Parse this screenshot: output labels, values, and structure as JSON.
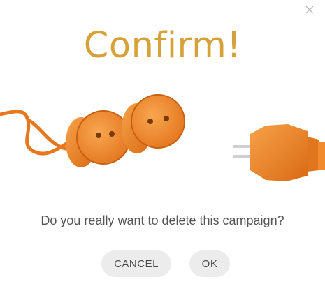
{
  "dialog": {
    "title": "Confirm!",
    "message": "Do you really want to delete this campaign?",
    "close_icon": "close-icon",
    "illustration": "unplugged-orange-power-cord",
    "buttons": {
      "cancel_label": "CANCEL",
      "ok_label": "OK"
    }
  },
  "colors": {
    "title": "#d7a13a",
    "plug_orange": "#f0852a",
    "button_bg": "#ececec",
    "text": "#555555"
  }
}
